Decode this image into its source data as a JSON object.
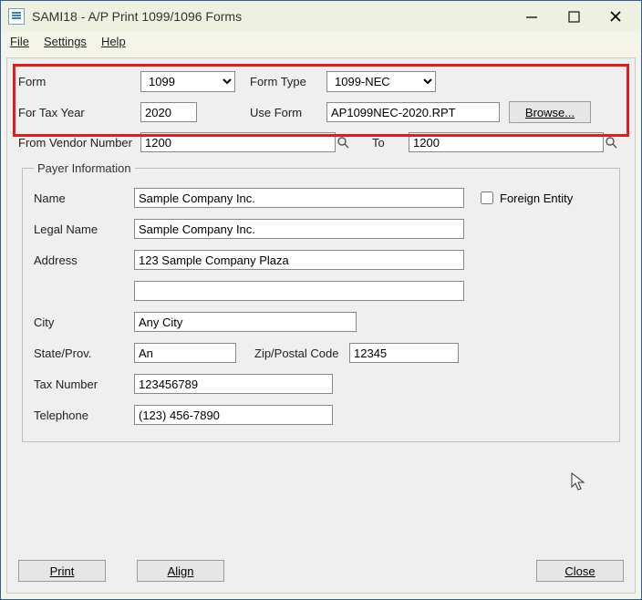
{
  "window": {
    "title": "SAMI18 - A/P Print 1099/1096 Forms"
  },
  "menu": {
    "file": "File",
    "settings": "Settings",
    "help": "Help"
  },
  "top": {
    "form_label": "Form",
    "form_value": "1099",
    "form_type_label": "Form Type",
    "form_type_value": "1099-NEC",
    "tax_year_label": "For Tax Year",
    "tax_year_value": "2020",
    "use_form_label": "Use Form",
    "use_form_value": "AP1099NEC-2020.RPT",
    "browse_label": "Browse...",
    "from_vendor_label": "From Vendor Number",
    "from_vendor_value": "1200",
    "to_label": "To",
    "to_vendor_value": "1200"
  },
  "payer": {
    "legend": "Payer Information",
    "name_label": "Name",
    "name_value": "Sample Company Inc.",
    "foreign_label": "Foreign Entity",
    "foreign_checked": false,
    "legal_label": "Legal Name",
    "legal_value": "Sample Company Inc.",
    "address_label": "Address",
    "address1_value": "123 Sample Company Plaza",
    "address2_value": "",
    "city_label": "City",
    "city_value": "Any City",
    "state_label": "State/Prov.",
    "state_value": "An",
    "zip_label": "Zip/Postal Code",
    "zip_value": "12345",
    "tax_label": "Tax Number",
    "tax_value": "123456789",
    "phone_label": "Telephone",
    "phone_value": "(123) 456-7890"
  },
  "buttons": {
    "print": "Print",
    "align": "Align",
    "close": "Close"
  }
}
